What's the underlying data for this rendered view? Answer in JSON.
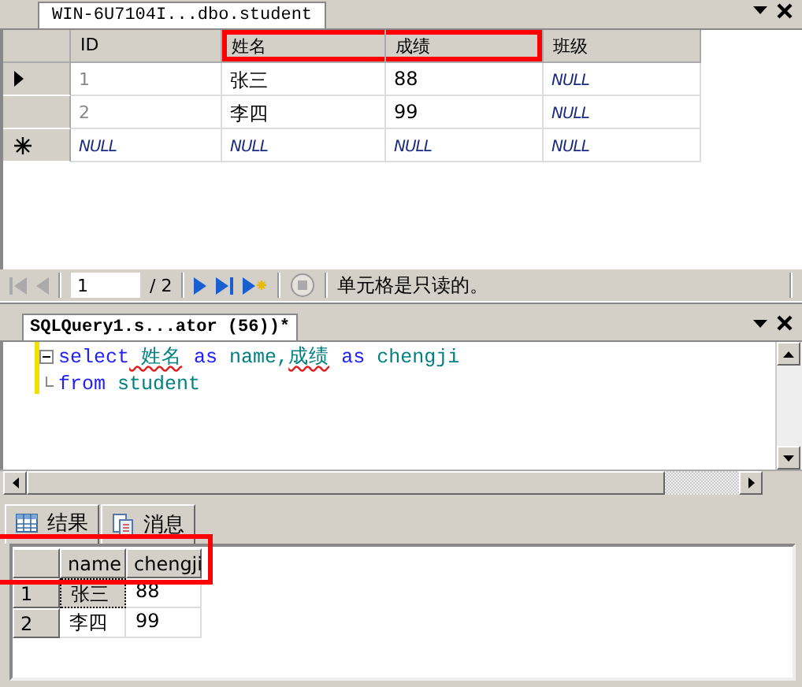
{
  "table_tab": {
    "title": "WIN-6U7104I...dbo.student",
    "selected": true
  },
  "table": {
    "columns": [
      {
        "label": "ID",
        "highlighted": false
      },
      {
        "label": "姓名",
        "highlighted": true
      },
      {
        "label": "成绩",
        "highlighted": true
      },
      {
        "label": "班级",
        "highlighted": false
      }
    ],
    "rows": [
      {
        "kind": "current",
        "cells": [
          {
            "text": "1",
            "null": false
          },
          {
            "text": "张三",
            "null": false
          },
          {
            "text": "88",
            "null": false
          },
          {
            "text": "NULL",
            "null": true
          }
        ]
      },
      {
        "kind": "normal",
        "cells": [
          {
            "text": "2",
            "null": false
          },
          {
            "text": "李四",
            "null": false
          },
          {
            "text": "99",
            "null": false
          },
          {
            "text": "NULL",
            "null": true
          }
        ]
      },
      {
        "kind": "new",
        "cells": [
          {
            "text": "NULL",
            "null": true
          },
          {
            "text": "NULL",
            "null": true
          },
          {
            "text": "NULL",
            "null": true
          },
          {
            "text": "NULL",
            "null": true
          }
        ]
      }
    ]
  },
  "navigator": {
    "first_disabled": true,
    "previous_disabled": true,
    "page": "1",
    "page_count": "/ 2",
    "stop_disabled": true,
    "status": "单元格是只读的。"
  },
  "query_tab": {
    "title": "SQLQuery1.s...ator (56))*",
    "selected": true
  },
  "editor": {
    "lines": [
      {
        "tokens": [
          {
            "t": "select",
            "kind": "keyword",
            "squiggle": false
          },
          {
            "t": " 姓名",
            "kind": "ident",
            "squiggle": true
          },
          {
            "t": " as",
            "kind": "keyword",
            "squiggle": false
          },
          {
            "t": " name,",
            "kind": "ident",
            "squiggle": false
          },
          {
            "t": "成绩",
            "kind": "ident",
            "squiggle": true
          },
          {
            "t": " as",
            "kind": "keyword",
            "squiggle": false
          },
          {
            "t": " chengji",
            "kind": "ident",
            "squiggle": false
          }
        ]
      },
      {
        "tokens": [
          {
            "t": "from",
            "kind": "keyword",
            "squiggle": false
          },
          {
            "t": " student",
            "kind": "ident",
            "squiggle": false
          }
        ]
      }
    ]
  },
  "result_tabs": [
    {
      "label": "结果",
      "kind": "grid",
      "selected": true
    },
    {
      "label": "消息",
      "kind": "messages",
      "selected": false
    }
  ],
  "results": {
    "highlighted": true,
    "columns": [
      "name",
      "chengji"
    ],
    "rows": [
      {
        "number": "1",
        "cells": [
          {
            "text": "张三",
            "focused": true
          },
          {
            "text": "88",
            "focused": false
          }
        ]
      },
      {
        "number": "2",
        "cells": [
          {
            "text": "李四",
            "focused": false
          },
          {
            "text": "99",
            "focused": false
          }
        ]
      }
    ]
  }
}
